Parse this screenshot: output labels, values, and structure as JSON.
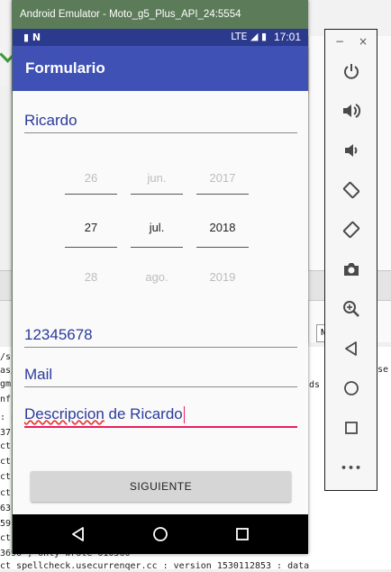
{
  "emulator": {
    "title": "Android Emulator - Moto_g5_Plus_API_24:5554"
  },
  "status_bar": {
    "time": "17:01",
    "left_icons": "▮ N",
    "right_icons": "LTE ◢ ▮"
  },
  "app": {
    "title": "Formulario",
    "name_field": "Ricardo",
    "date_picker": {
      "day": {
        "prev": "26",
        "selected": "27",
        "next": "28"
      },
      "month": {
        "prev": "jun.",
        "selected": "jul.",
        "next": "ago."
      },
      "year": {
        "prev": "2017",
        "selected": "2018",
        "next": "2019"
      }
    },
    "phone_field": "12345678",
    "mail_field": "Mail",
    "description_field": {
      "word1": "Descripcion",
      "rest": " de Ricardo"
    },
    "next_button": "SIGUIENTE"
  },
  "toolbar": {
    "minimize": "−",
    "close": "×",
    "items": [
      "power-icon",
      "volume-up-icon",
      "volume-down-icon",
      "rotate-left-icon",
      "rotate-right-icon",
      "camera-icon",
      "zoom-icon",
      "back-icon",
      "home-icon",
      "overview-icon",
      "more-icon"
    ],
    "more_label": "•••"
  },
  "ide": {
    "console_left": [
      "/s",
      "as/",
      "gm",
      "nf",
      ": p",
      "37",
      "ct",
      "ct",
      "ct",
      "ct",
      "63",
      "59",
      "ct"
    ],
    "console_bottom": "3696 , only wrote 610560",
    "console_last": "ct  spellcheck.usecurrenqer.cc : version   1530112853 : data",
    "console_right_1": "jn",
    "console_right_1b": "se",
    "console_right_2": "ds",
    "n_box": "N"
  },
  "colors": {
    "primary": "#3f51b5",
    "primary_dark": "#2c3a8e",
    "accent": "#e91e63",
    "field_text": "#2a3a9c",
    "emulator_titlebar": "#5b7b59"
  }
}
